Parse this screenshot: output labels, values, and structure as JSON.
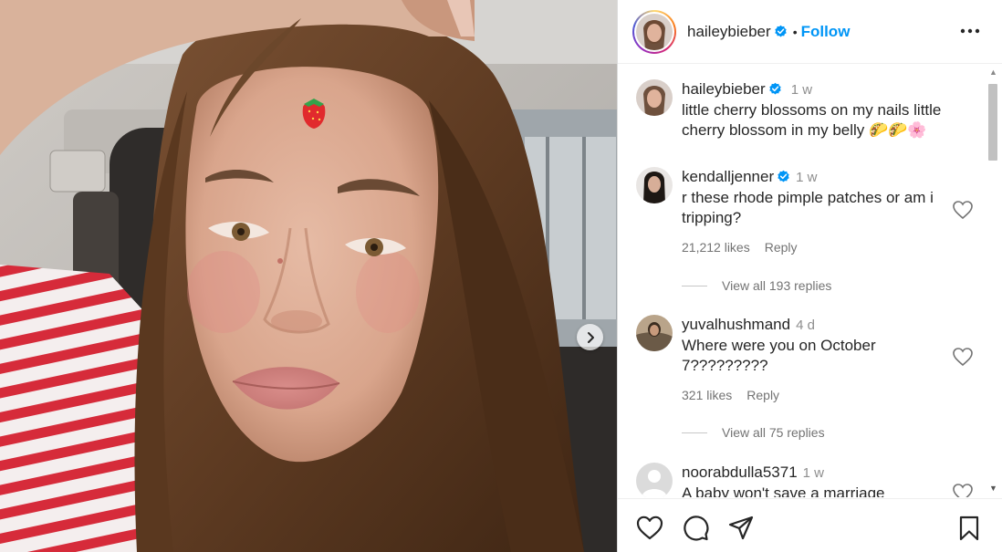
{
  "post": {
    "author": "haileybieber",
    "separator": "•",
    "follow_label": "Follow",
    "more_icon": "more-horizontal-icon",
    "next_icon": "chevron-right-icon"
  },
  "caption": {
    "user": "haileybieber",
    "time": "1 w",
    "text": "little cherry blossoms on my nails little cherry blossom in my belly",
    "emojis": [
      "🌮",
      "🌮",
      "🌸"
    ]
  },
  "comments": [
    {
      "user": "kendalljenner",
      "verified": true,
      "time": "1 w",
      "text": "r these rhode pimple patches or am i tripping?",
      "likes": "21,212 likes",
      "reply_label": "Reply",
      "view_replies": "View all 193 replies"
    },
    {
      "user": "yuvalhushmand",
      "verified": false,
      "time": "4 d",
      "text": "Where were you on October 7?????????",
      "likes": "321 likes",
      "reply_label": "Reply",
      "view_replies": "View all 75 replies"
    },
    {
      "user": "noorabdulla5371",
      "verified": false,
      "time": "1 w",
      "text": "A baby won't save a marriage"
    }
  ],
  "actions": {
    "like_icon": "heart-icon",
    "comment_icon": "comment-icon",
    "share_icon": "share-icon",
    "save_icon": "bookmark-icon"
  },
  "colors": {
    "link": "#0095f6",
    "verified": "#0095f6",
    "muted": "#737373"
  }
}
